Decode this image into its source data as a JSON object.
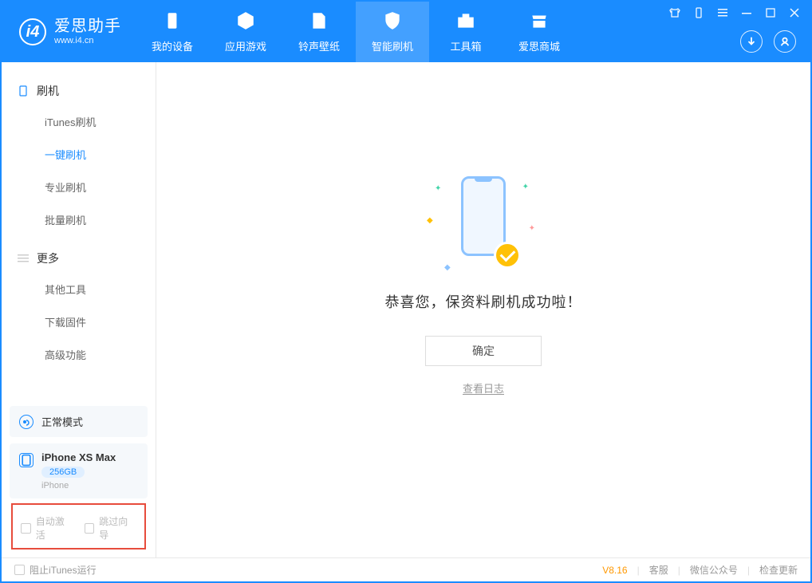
{
  "app": {
    "logo_char": "i4",
    "title": "爱思助手",
    "subtitle": "www.i4.cn"
  },
  "nav": [
    {
      "label": "我的设备"
    },
    {
      "label": "应用游戏"
    },
    {
      "label": "铃声壁纸"
    },
    {
      "label": "智能刷机"
    },
    {
      "label": "工具箱"
    },
    {
      "label": "爱思商城"
    }
  ],
  "sidebar": {
    "group1": {
      "title": "刷机",
      "items": [
        "iTunes刷机",
        "一键刷机",
        "专业刷机",
        "批量刷机"
      ]
    },
    "group2": {
      "title": "更多",
      "items": [
        "其他工具",
        "下载固件",
        "高级功能"
      ]
    }
  },
  "status": {
    "mode": "正常模式"
  },
  "device": {
    "name": "iPhone XS Max",
    "storage": "256GB",
    "type": "iPhone"
  },
  "options": {
    "auto_activate": "自动激活",
    "skip_guide": "跳过向导"
  },
  "main": {
    "success_text": "恭喜您，保资料刷机成功啦！",
    "confirm": "确定",
    "view_log": "查看日志"
  },
  "footer": {
    "block_itunes": "阻止iTunes运行",
    "version": "V8.16",
    "support": "客服",
    "wechat": "微信公众号",
    "update": "检查更新"
  }
}
